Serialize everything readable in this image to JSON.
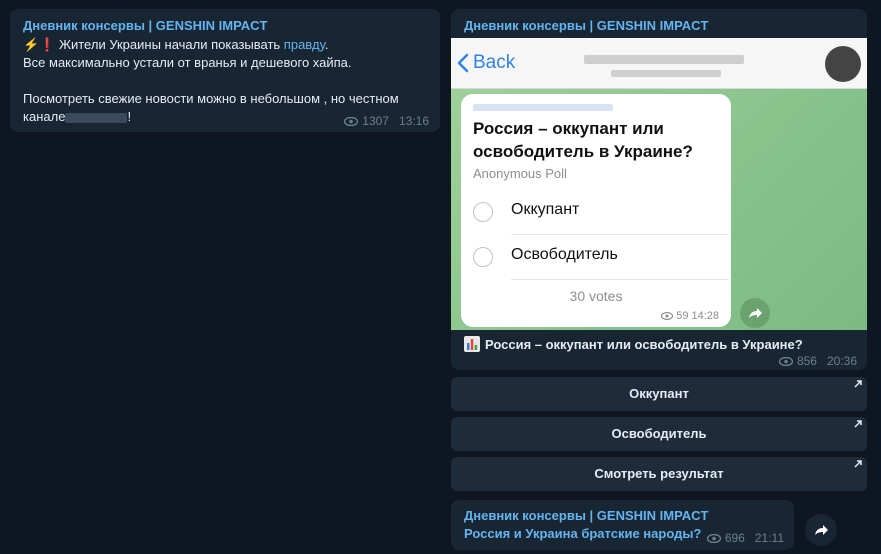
{
  "messages": {
    "post1": {
      "author": "Дневник консервы | GENSHIN IMPACT",
      "line1_emoji": "⚡❗",
      "line1_before": " Жители Украины начали показывать ",
      "line1_link": "правду",
      "line1_after": ".",
      "line2": "Все максимально устали от вранья и дешевого хайпа.",
      "line3_before": "Посмотреть свежие новости можно в небольшом , но честном",
      "line3_channel_prefix": "канале",
      "line3_end": "!",
      "views": "1307",
      "time": "13:16"
    },
    "post2": {
      "author": "Дневник консервы | GENSHIN IMPACT",
      "screenshot": {
        "back_label": "Back",
        "poll_question": "Россия – оккупант или освободитель в Украине?",
        "poll_type": "Anonymous Poll",
        "options": [
          "Оккупант",
          "Освободитель"
        ],
        "votes": "30 votes",
        "views": "59",
        "time": "14:28"
      },
      "caption": "Россия – оккупант или освободитель в Украине?",
      "views": "856",
      "time": "20:36"
    },
    "buttons": {
      "b1": "Оккупант",
      "b2": "Освободитель",
      "b3": "Смотреть результат"
    },
    "post3": {
      "author": "Дневник консервы | GENSHIN IMPACT",
      "text": "Россия и Украина братские народы?",
      "views": "696",
      "time": "21:11"
    }
  },
  "colors": {
    "background": "#0e1621",
    "bubble": "#182533",
    "accent": "#64b5ef",
    "button": "#1d2b3b"
  }
}
